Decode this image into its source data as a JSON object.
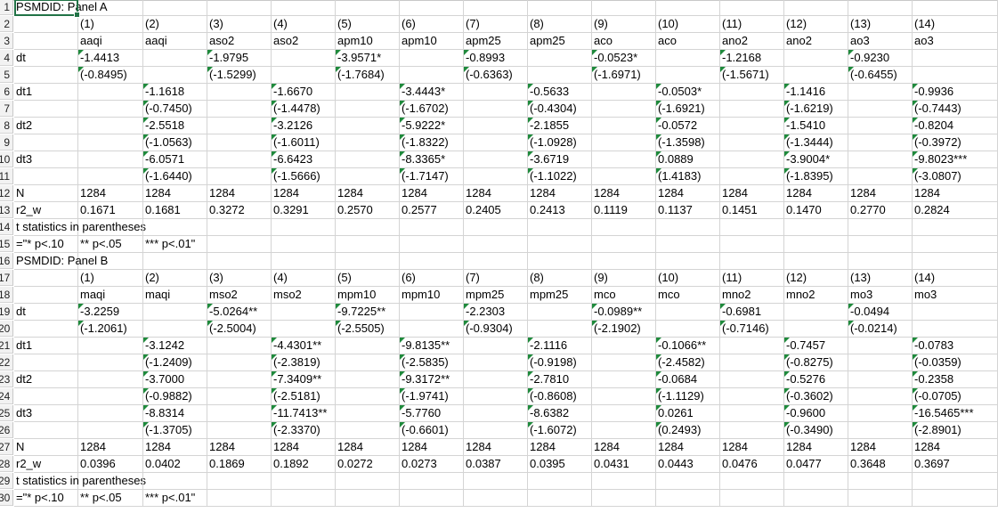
{
  "sheet": {
    "row_numbers": [
      "1",
      "2",
      "3",
      "4",
      "5",
      "6",
      "7",
      "8",
      "9",
      "10",
      "11",
      "12",
      "13",
      "14",
      "15",
      "16",
      "17",
      "18",
      "19",
      "20",
      "21",
      "22",
      "23",
      "24",
      "25",
      "26",
      "27",
      "28",
      "29",
      "30"
    ],
    "rows": [
      {
        "cells": [
          "PSMDID: Panel A",
          "",
          "",
          "",
          "",
          "",
          "",
          "",
          "",
          "",
          "",
          "",
          "",
          "",
          ""
        ]
      },
      {
        "cells": [
          "",
          "(1)",
          "(2)",
          "(3)",
          "(4)",
          "(5)",
          "(6)",
          "(7)",
          "(8)",
          "(9)",
          "(10)",
          "(11)",
          "(12)",
          "(13)",
          "(14)"
        ]
      },
      {
        "cells": [
          "",
          "aaqi",
          "aaqi",
          "aso2",
          "aso2",
          "apm10",
          "apm10",
          "apm25",
          "apm25",
          "aco",
          "aco",
          "ano2",
          "ano2",
          "ao3",
          "ao3"
        ]
      },
      {
        "cells": [
          "dt",
          "-1.4413",
          "",
          "-1.9795",
          "",
          "-3.9571*",
          "",
          "-0.8993",
          "",
          "-0.0523*",
          "",
          "-1.2168",
          "",
          "-0.9230",
          ""
        ]
      },
      {
        "cells": [
          "",
          "(-0.8495)",
          "",
          "(-1.5299)",
          "",
          "(-1.7684)",
          "",
          "(-0.6363)",
          "",
          "(-1.6971)",
          "",
          "(-1.5671)",
          "",
          "(-0.6455)",
          ""
        ]
      },
      {
        "cells": [
          "dt1",
          "",
          "-1.1618",
          "",
          "-1.6670",
          "",
          "-3.4443*",
          "",
          "-0.5633",
          "",
          "-0.0503*",
          "",
          "-1.1416",
          "",
          "-0.9936"
        ]
      },
      {
        "cells": [
          "",
          "",
          "(-0.7450)",
          "",
          "(-1.4478)",
          "",
          "(-1.6702)",
          "",
          "(-0.4304)",
          "",
          "(-1.6921)",
          "",
          "(-1.6219)",
          "",
          "(-0.7443)"
        ]
      },
      {
        "cells": [
          "dt2",
          "",
          "-2.5518",
          "",
          "-3.2126",
          "",
          "-5.9222*",
          "",
          "-2.1855",
          "",
          "-0.0572",
          "",
          "-1.5410",
          "",
          "-0.8204"
        ]
      },
      {
        "cells": [
          "",
          "",
          "(-1.0563)",
          "",
          "(-1.6011)",
          "",
          "(-1.8322)",
          "",
          "(-1.0928)",
          "",
          "(-1.3598)",
          "",
          "(-1.3444)",
          "",
          "(-0.3972)"
        ]
      },
      {
        "cells": [
          "dt3",
          "",
          "-6.0571",
          "",
          "-6.6423",
          "",
          "-8.3365*",
          "",
          "-3.6719",
          "",
          "0.0889",
          "",
          "-3.9004*",
          "",
          "-9.8023***"
        ]
      },
      {
        "cells": [
          "",
          "",
          "(-1.6440)",
          "",
          "(-1.5666)",
          "",
          "(-1.7147)",
          "",
          "(-1.1022)",
          "",
          "(1.4183)",
          "",
          "(-1.8395)",
          "",
          "(-3.0807)"
        ]
      },
      {
        "cells": [
          "N",
          "1284",
          "1284",
          "1284",
          "1284",
          "1284",
          "1284",
          "1284",
          "1284",
          "1284",
          "1284",
          "1284",
          "1284",
          "1284",
          "1284"
        ]
      },
      {
        "cells": [
          "r2_w",
          "0.1671",
          "0.1681",
          "0.3272",
          "0.3291",
          "0.2570",
          "0.2577",
          "0.2405",
          "0.2413",
          "0.1119",
          "0.1137",
          "0.1451",
          "0.1470",
          "0.2770",
          "0.2824"
        ]
      },
      {
        "cells": [
          "t statistics in parentheses",
          "",
          "",
          "",
          "",
          "",
          "",
          "",
          "",
          "",
          "",
          "",
          "",
          "",
          ""
        ]
      },
      {
        "cells": [
          "=\"* p<.10",
          "** p<.05",
          "*** p<.01\"",
          "",
          "",
          "",
          "",
          "",
          "",
          "",
          "",
          "",
          "",
          "",
          ""
        ]
      },
      {
        "cells": [
          "PSMDID: Panel B",
          "",
          "",
          "",
          "",
          "",
          "",
          "",
          "",
          "",
          "",
          "",
          "",
          "",
          ""
        ]
      },
      {
        "cells": [
          "",
          "(1)",
          "(2)",
          "(3)",
          "(4)",
          "(5)",
          "(6)",
          "(7)",
          "(8)",
          "(9)",
          "(10)",
          "(11)",
          "(12)",
          "(13)",
          "(14)"
        ]
      },
      {
        "cells": [
          "",
          "maqi",
          "maqi",
          "mso2",
          "mso2",
          "mpm10",
          "mpm10",
          "mpm25",
          "mpm25",
          "mco",
          "mco",
          "mno2",
          "mno2",
          "mo3",
          "mo3"
        ]
      },
      {
        "cells": [
          "dt",
          "-3.2259",
          "",
          "-5.0264**",
          "",
          "-9.7225**",
          "",
          "-2.2303",
          "",
          "-0.0989**",
          "",
          "-0.6981",
          "",
          "-0.0494",
          ""
        ]
      },
      {
        "cells": [
          "",
          "(-1.2061)",
          "",
          "(-2.5004)",
          "",
          "(-2.5505)",
          "",
          "(-0.9304)",
          "",
          "(-2.1902)",
          "",
          "(-0.7146)",
          "",
          "(-0.0214)",
          ""
        ]
      },
      {
        "cells": [
          "dt1",
          "",
          "-3.1242",
          "",
          "-4.4301**",
          "",
          "-9.8135**",
          "",
          "-2.1116",
          "",
          "-0.1066**",
          "",
          "-0.7457",
          "",
          "-0.0783"
        ]
      },
      {
        "cells": [
          "",
          "",
          "(-1.2409)",
          "",
          "(-2.3819)",
          "",
          "(-2.5835)",
          "",
          "(-0.9198)",
          "",
          "(-2.4582)",
          "",
          "(-0.8275)",
          "",
          "(-0.0359)"
        ]
      },
      {
        "cells": [
          "dt2",
          "",
          "-3.7000",
          "",
          "-7.3409**",
          "",
          "-9.3172**",
          "",
          "-2.7810",
          "",
          "-0.0684",
          "",
          "-0.5276",
          "",
          "-0.2358"
        ]
      },
      {
        "cells": [
          "",
          "",
          "(-0.9882)",
          "",
          "(-2.5181)",
          "",
          "(-1.9741)",
          "",
          "(-0.8608)",
          "",
          "(-1.1129)",
          "",
          "(-0.3602)",
          "",
          "(-0.0705)"
        ]
      },
      {
        "cells": [
          "dt3",
          "",
          "-8.8314",
          "",
          "-11.7413**",
          "",
          "-5.7760",
          "",
          "-8.6382",
          "",
          "0.0261",
          "",
          "-0.9600",
          "",
          "-16.5465***"
        ]
      },
      {
        "cells": [
          "",
          "",
          "(-1.3705)",
          "",
          "(-2.3370)",
          "",
          "(-0.6601)",
          "",
          "(-1.6072)",
          "",
          "(0.2493)",
          "",
          "(-0.3490)",
          "",
          "(-2.8901)"
        ]
      },
      {
        "cells": [
          "N",
          "1284",
          "1284",
          "1284",
          "1284",
          "1284",
          "1284",
          "1284",
          "1284",
          "1284",
          "1284",
          "1284",
          "1284",
          "1284",
          "1284"
        ]
      },
      {
        "cells": [
          "r2_w",
          "0.0396",
          "0.0402",
          "0.1869",
          "0.1892",
          "0.0272",
          "0.0273",
          "0.0387",
          "0.0395",
          "0.0431",
          "0.0443",
          "0.0476",
          "0.0477",
          "0.3648",
          "0.3697"
        ]
      },
      {
        "cells": [
          "t statistics in parentheses",
          "",
          "",
          "",
          "",
          "",
          "",
          "",
          "",
          "",
          "",
          "",
          "",
          "",
          ""
        ]
      },
      {
        "cells": [
          "=\"* p<.10",
          "** p<.05",
          "*** p<.01\"",
          "",
          "",
          "",
          "",
          "",
          "",
          "",
          "",
          "",
          "",
          "",
          ""
        ]
      }
    ]
  }
}
